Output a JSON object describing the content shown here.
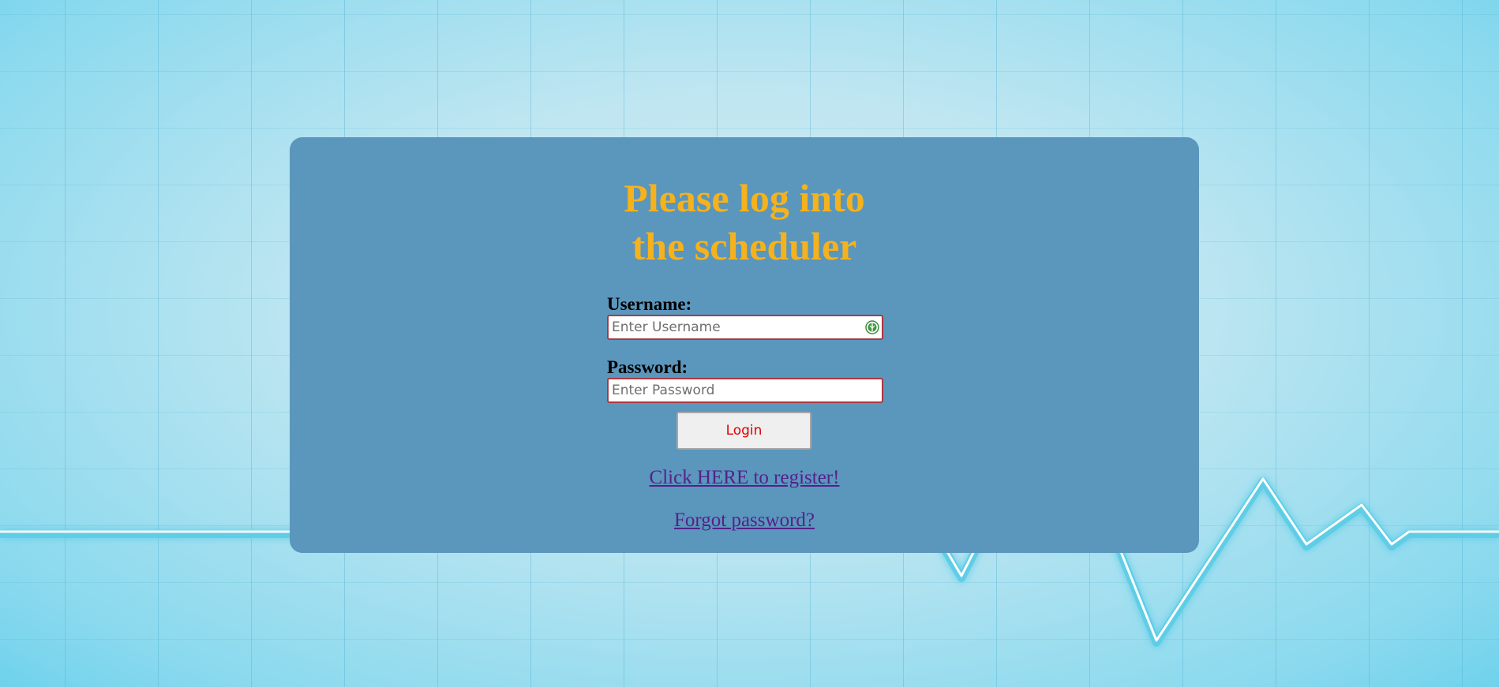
{
  "login": {
    "title_line1": "Please log into",
    "title_line2": "the scheduler",
    "username_label": "Username:",
    "username_placeholder": "Enter Username",
    "username_value": "",
    "password_label": "Password:",
    "password_placeholder": "Enter Password",
    "password_value": "",
    "login_button": "Login",
    "register_link": "Click HERE to register!",
    "forgot_link": "Forgot password?"
  },
  "icons": {
    "username_field_icon": "password-manager-icon"
  },
  "colors": {
    "card_background": "#5b96bd",
    "title": "#f5b21c",
    "input_border": "#a83a44",
    "button_text": "#e00000",
    "link": "#55218b"
  }
}
